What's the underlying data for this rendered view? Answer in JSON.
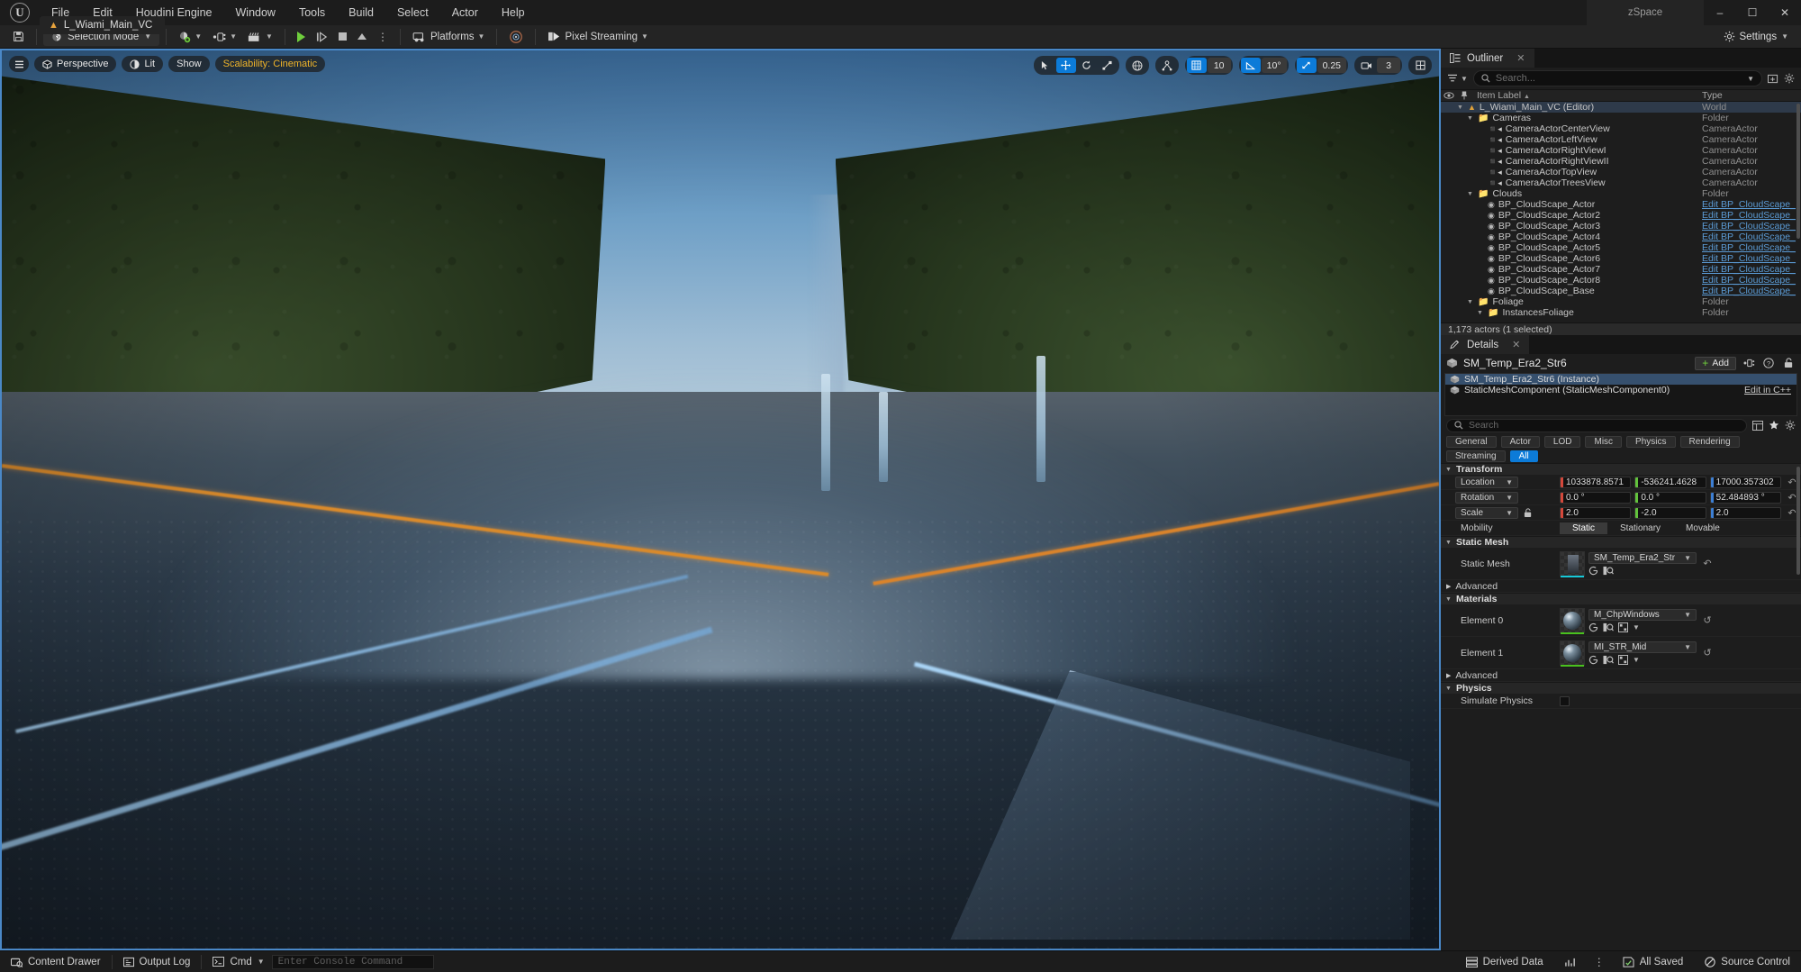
{
  "titlebar": {
    "menus": [
      "File",
      "Edit",
      "Houdini Engine",
      "Window",
      "Tools",
      "Build",
      "Select",
      "Actor",
      "Help"
    ],
    "window_title": "zSpace",
    "minimize": "–",
    "maximize": "☐",
    "close": "✕",
    "level_tab": "L_Wiami_Main_VC"
  },
  "toolbar": {
    "save_icon": "save-icon",
    "selection_mode": "Selection Mode",
    "add_icon": "add-actor-icon",
    "blueprint_icon": "blueprint-icon",
    "cinematics_icon": "cinematics-icon",
    "play": "play-icon",
    "skip": "step-icon",
    "stop": "stop-icon",
    "eject": "eject-icon",
    "more": "more-options-icon",
    "platforms": "Platforms",
    "lighting_icon": "lighting-build-icon",
    "pixel_streaming": "Pixel Streaming",
    "settings": "Settings"
  },
  "viewport": {
    "menu_icon": "viewport-menu-icon",
    "perspective": "Perspective",
    "lit": "Lit",
    "show": "Show",
    "scalability": "Scalability: Cinematic",
    "tools": {
      "select": "select-cursor-icon",
      "translate": "translate-gizmo-icon",
      "rotate": "rotate-gizmo-icon",
      "scale": "scale-gizmo-icon",
      "world_coord": "world-coordinate-icon",
      "surface_snap": "surface-snapping-icon",
      "grid_snap_icon": "grid-snap-icon",
      "grid_snap_value": "10",
      "angle_snap_icon": "angle-snap-icon",
      "angle_snap_value": "10°",
      "scale_snap_icon": "scale-snap-icon",
      "scale_snap_value": "0.25",
      "camera_speed_icon": "camera-speed-icon",
      "camera_speed_value": "3",
      "layout_icon": "viewport-layout-icon"
    }
  },
  "outliner": {
    "tab_label": "Outliner",
    "close": "✕",
    "filter_icon": "filter-icon",
    "search_placeholder": "Search...",
    "search_value": "",
    "new_folder_icon": "new-folder-icon",
    "settings_icon": "settings-gear-icon",
    "columns": {
      "eye": "eye-icon",
      "pin": "pin-icon",
      "label": "Item Label",
      "sort": "▲",
      "type": "Type"
    },
    "rows": [
      {
        "label": "L_Wiami_Main_VC (Editor)",
        "type": "World",
        "indent": 1,
        "arrow": "▼",
        "icon": "world-icon",
        "selected": true,
        "link": false
      },
      {
        "label": "Cameras",
        "type": "Folder",
        "indent": 2,
        "arrow": "▼",
        "icon": "folder-icon",
        "selected": false,
        "link": false
      },
      {
        "label": "CameraActorCenterView",
        "type": "CameraActor",
        "indent": 3,
        "arrow": "",
        "icon": "camera-icon",
        "selected": false,
        "link": false
      },
      {
        "label": "CameraActorLeftView",
        "type": "CameraActor",
        "indent": 3,
        "arrow": "",
        "icon": "camera-icon",
        "selected": false,
        "link": false
      },
      {
        "label": "CameraActorRightViewI",
        "type": "CameraActor",
        "indent": 3,
        "arrow": "",
        "icon": "camera-icon",
        "selected": false,
        "link": false
      },
      {
        "label": "CameraActorRightViewII",
        "type": "CameraActor",
        "indent": 3,
        "arrow": "",
        "icon": "camera-icon",
        "selected": false,
        "link": false
      },
      {
        "label": "CameraActorTopView",
        "type": "CameraActor",
        "indent": 3,
        "arrow": "",
        "icon": "camera-icon",
        "selected": false,
        "link": false
      },
      {
        "label": "CameraActorTreesView",
        "type": "CameraActor",
        "indent": 3,
        "arrow": "",
        "icon": "camera-icon",
        "selected": false,
        "link": false
      },
      {
        "label": "Clouds",
        "type": "Folder",
        "indent": 2,
        "arrow": "▼",
        "icon": "folder-icon",
        "selected": false,
        "link": false
      },
      {
        "label": "BP_CloudScape_Actor",
        "type": "Edit BP_CloudScape_",
        "indent": 3,
        "arrow": "",
        "icon": "blueprint-icon",
        "selected": false,
        "link": true
      },
      {
        "label": "BP_CloudScape_Actor2",
        "type": "Edit BP_CloudScape_",
        "indent": 3,
        "arrow": "",
        "icon": "blueprint-icon",
        "selected": false,
        "link": true
      },
      {
        "label": "BP_CloudScape_Actor3",
        "type": "Edit BP_CloudScape_",
        "indent": 3,
        "arrow": "",
        "icon": "blueprint-icon",
        "selected": false,
        "link": true
      },
      {
        "label": "BP_CloudScape_Actor4",
        "type": "Edit BP_CloudScape_",
        "indent": 3,
        "arrow": "",
        "icon": "blueprint-icon",
        "selected": false,
        "link": true
      },
      {
        "label": "BP_CloudScape_Actor5",
        "type": "Edit BP_CloudScape_",
        "indent": 3,
        "arrow": "",
        "icon": "blueprint-icon",
        "selected": false,
        "link": true
      },
      {
        "label": "BP_CloudScape_Actor6",
        "type": "Edit BP_CloudScape_",
        "indent": 3,
        "arrow": "",
        "icon": "blueprint-icon",
        "selected": false,
        "link": true
      },
      {
        "label": "BP_CloudScape_Actor7",
        "type": "Edit BP_CloudScape_",
        "indent": 3,
        "arrow": "",
        "icon": "blueprint-icon",
        "selected": false,
        "link": true
      },
      {
        "label": "BP_CloudScape_Actor8",
        "type": "Edit BP_CloudScape_",
        "indent": 3,
        "arrow": "",
        "icon": "blueprint-icon",
        "selected": false,
        "link": true
      },
      {
        "label": "BP_CloudScape_Base",
        "type": "Edit BP_CloudScape_",
        "indent": 3,
        "arrow": "",
        "icon": "blueprint-icon",
        "selected": false,
        "link": true
      },
      {
        "label": "Foliage",
        "type": "Folder",
        "indent": 2,
        "arrow": "▼",
        "icon": "folder-icon",
        "selected": false,
        "link": false
      },
      {
        "label": "InstancesFoliage",
        "type": "Folder",
        "indent": 3,
        "arrow": "▼",
        "icon": "folder-icon",
        "selected": false,
        "link": false
      }
    ],
    "status": "1,173 actors (1 selected)"
  },
  "details": {
    "tab_label": "Details",
    "close": "✕",
    "actor_name": "SM_Temp_Era2_Str6",
    "add_label": "Add",
    "components": [
      {
        "label": "SM_Temp_Era2_Str6 (Instance)",
        "selected": true,
        "right": ""
      },
      {
        "label": "StaticMeshComponent (StaticMeshComponent0)",
        "selected": false,
        "right": "Edit in C++"
      }
    ],
    "search_placeholder": "Search",
    "search_value": "",
    "column_icon": "column-layout-icon",
    "favorite_icon": "star-icon",
    "gear_icon": "settings-gear-icon",
    "filter_chips": [
      "General",
      "Actor",
      "LOD",
      "Misc",
      "Physics",
      "Rendering"
    ],
    "filter_chips2": [
      {
        "label": "Streaming",
        "active": false
      },
      {
        "label": "All",
        "active": true
      }
    ],
    "transform": {
      "section": "Transform",
      "location": {
        "label": "Location",
        "mode": "Location",
        "x": "1033878.8571",
        "y": "-536241.4628",
        "z": "17000.357302"
      },
      "rotation": {
        "label": "Rotation",
        "mode": "Rotation",
        "x": "0.0 °",
        "y": "0.0 °",
        "z": "52.484893 °"
      },
      "scale": {
        "label": "Scale",
        "mode": "Scale",
        "x": "2.0",
        "y": "-2.0",
        "z": "2.0",
        "lock_icon": "unlocked-icon"
      },
      "mobility": {
        "label": "Mobility",
        "options": [
          "Static",
          "Stationary",
          "Movable"
        ],
        "selected": "Static"
      }
    },
    "static_mesh": {
      "section": "Static Mesh",
      "label": "Static Mesh",
      "value": "SM_Temp_Era2_Str",
      "advanced": "Advanced"
    },
    "materials": {
      "section": "Materials",
      "elements": [
        {
          "label": "Element 0",
          "value": "M_ChpWindows"
        },
        {
          "label": "Element 1",
          "value": "MI_STR_Mid"
        }
      ],
      "advanced": "Advanced"
    },
    "physics": {
      "section": "Physics",
      "simulate_label": "Simulate Physics",
      "simulate_checked": false
    }
  },
  "statusbar": {
    "content_drawer": "Content Drawer",
    "output_log": "Output Log",
    "cmd": "Cmd",
    "console_placeholder": "Enter Console Command",
    "console_value": "",
    "derived_data": "Derived Data",
    "stats_icon": "stats-icon",
    "more_icon": "more-icon",
    "all_saved": "All Saved",
    "source_control": "Source Control"
  },
  "colors": {
    "accent": "#0c7bd8",
    "viewport_border": "#4a88c7",
    "scalability": "#f0b429",
    "link": "#5b9bd5",
    "axis_x": "#d4483b",
    "axis_y": "#62c23c",
    "axis_z": "#3d7fd4",
    "play_green": "#6fce3d"
  }
}
